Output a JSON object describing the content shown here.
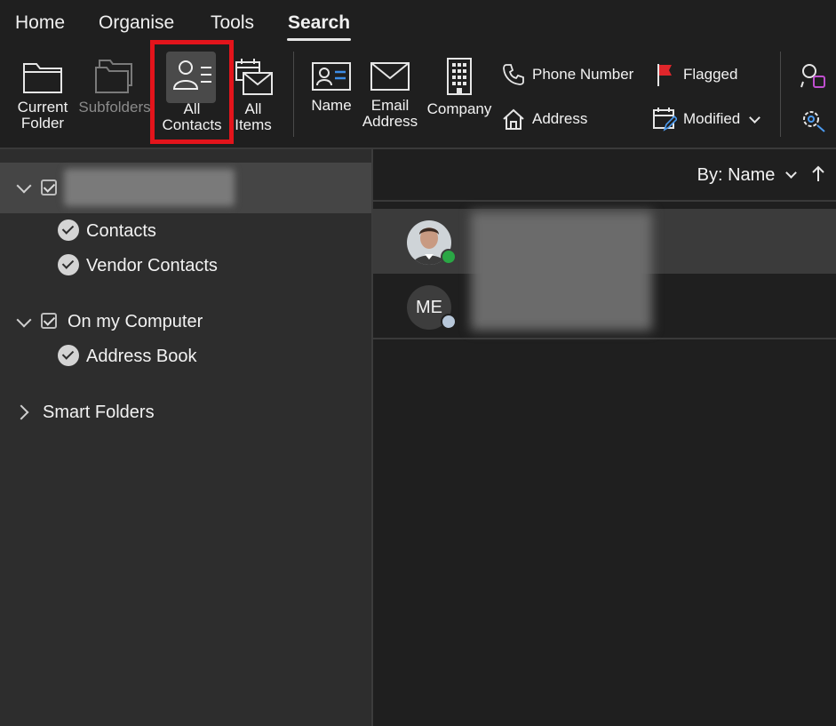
{
  "tabs": [
    {
      "label": "Home"
    },
    {
      "label": "Organise"
    },
    {
      "label": "Tools"
    },
    {
      "label": "Search"
    }
  ],
  "ribbon": {
    "current_folder": {
      "line1": "Current",
      "line2": "Folder"
    },
    "subfolders": {
      "label": "Subfolders"
    },
    "all_contacts": {
      "line1": "All",
      "line2": "Contacts"
    },
    "all_items": {
      "line1": "All",
      "line2": "Items"
    },
    "name": {
      "label": "Name"
    },
    "email_address": {
      "line1": "Email",
      "line2": "Address"
    },
    "company": {
      "label": "Company"
    },
    "phone_number": {
      "label": "Phone Number"
    },
    "address": {
      "label": "Address"
    },
    "flagged": {
      "label": "Flagged"
    },
    "modified": {
      "label": "Modified"
    }
  },
  "sidebar": {
    "contacts": {
      "label": "Contacts"
    },
    "vendor_contacts": {
      "label": "Vendor Contacts"
    },
    "on_my_computer": {
      "label": "On my Computer"
    },
    "address_book": {
      "label": "Address Book"
    },
    "smart_folders": {
      "label": "Smart Folders"
    }
  },
  "list": {
    "sort_label": "By: Name",
    "items": [
      {
        "initials": ""
      },
      {
        "initials": "ME"
      }
    ]
  },
  "icons": [
    "folder-icon",
    "subfolders-icon",
    "contact-card-icon",
    "all-items-icon",
    "name-card-icon",
    "envelope-icon",
    "building-icon",
    "phone-icon",
    "house-icon",
    "flag-icon",
    "calendar-edit-icon",
    "chevron-down-icon",
    "arrow-up-icon",
    "search-person-icon",
    "gear-search-icon",
    "checkbox-icon",
    "circle-check-icon"
  ],
  "colors": {
    "highlight": "#e3141b",
    "presence_online": "#2aa745",
    "flag": "#e0262b"
  }
}
